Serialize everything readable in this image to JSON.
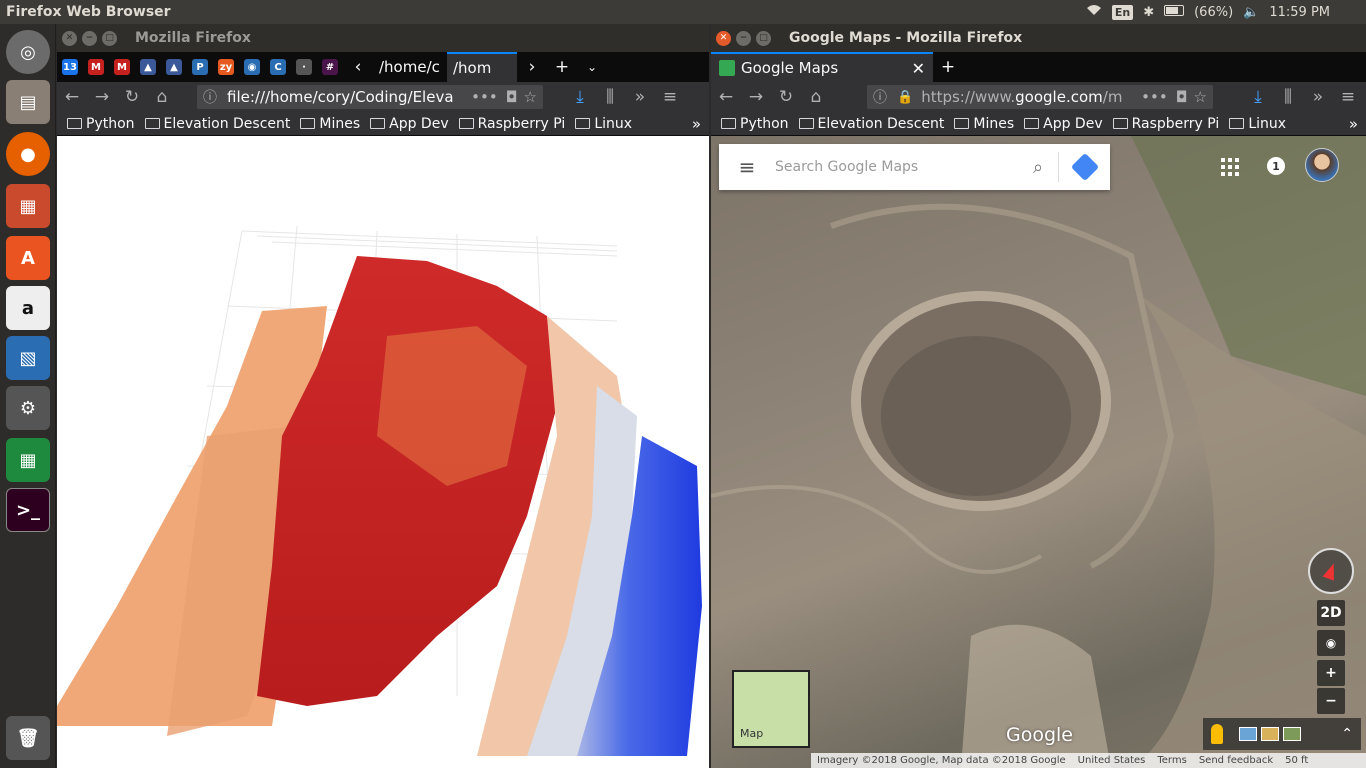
{
  "top_panel": {
    "title": "Firefox Web Browser",
    "lang": "En",
    "battery": "(66%)",
    "time": "11:59 PM"
  },
  "left_window": {
    "title": "Mozilla Firefox",
    "pinned_tabs": [
      {
        "label": "13",
        "color": "#1a73e8"
      },
      {
        "label": "M",
        "color": "#c5221f"
      },
      {
        "label": "M",
        "color": "#c5221f"
      },
      {
        "label": "▲",
        "color": "#3b5998"
      },
      {
        "label": "▲",
        "color": "#3b5998"
      },
      {
        "label": "P",
        "color": "#2a6db2"
      },
      {
        "label": "zy",
        "color": "#e55a21"
      },
      {
        "label": "👁",
        "color": "#2a6db2"
      },
      {
        "label": "C",
        "color": "#2a6db2"
      },
      {
        "label": "·",
        "color": "#555555"
      },
      {
        "label": "#",
        "color": "#4a154b"
      }
    ],
    "tabs": [
      "/home/c",
      "/hom"
    ],
    "url": "file:///home/cory/Coding/Eleva",
    "bookmarks": [
      "Python",
      "Elevation Descent",
      "Mines",
      "App Dev",
      "Raspberry Pi",
      "Linux"
    ]
  },
  "right_window": {
    "title": "Google Maps - Mozilla Firefox",
    "tab": "Google Maps",
    "url_prefix": "https://www.",
    "url_host": "google.com",
    "url_rest": "/m",
    "bookmarks": [
      "Python",
      "Elevation Descent",
      "Mines",
      "App Dev",
      "Raspberry Pi",
      "Linux"
    ]
  },
  "maps": {
    "search_placeholder": "Search Google Maps",
    "notification_count": "1",
    "view_toggle": "2D",
    "zoom_in": "+",
    "zoom_out": "−",
    "minimap_label": "Map",
    "logo": "Google",
    "attribution": [
      "Imagery ©2018 Google, Map data ©2018 Google",
      "United States",
      "Terms",
      "Send feedback",
      "50 ft"
    ]
  }
}
